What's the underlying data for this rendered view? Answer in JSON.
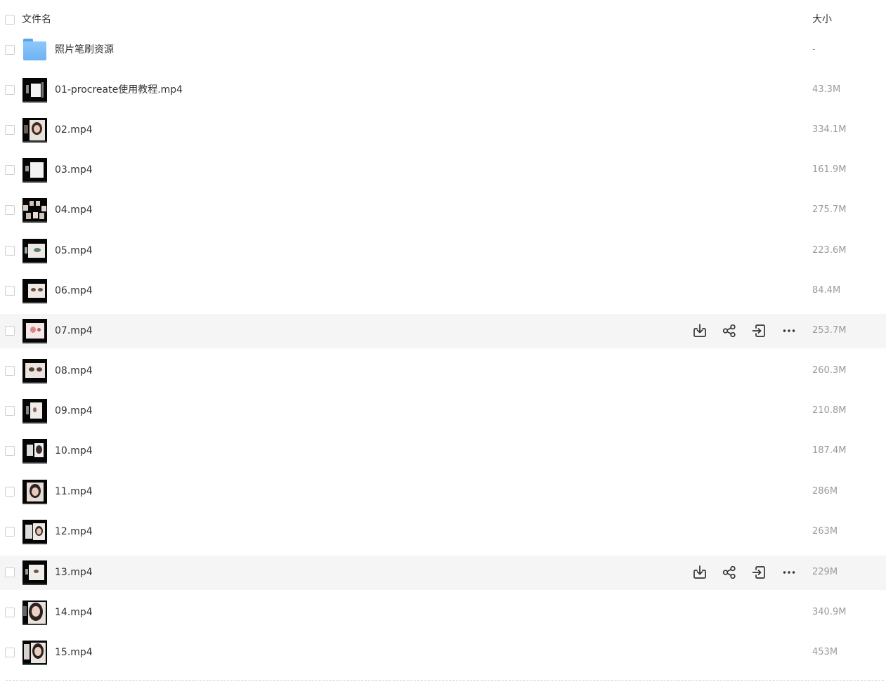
{
  "header": {
    "name_label": "文件名",
    "size_label": "大小"
  },
  "icons": {
    "download": "download-icon",
    "share": "share-icon",
    "move": "move-icon",
    "more": "more-icon",
    "folder": "folder-icon"
  },
  "files": [
    {
      "name": "照片笔刷资源",
      "size": "-",
      "type": "folder"
    },
    {
      "name": "01-procreate使用教程.mp4",
      "size": "43.3M",
      "type": "video"
    },
    {
      "name": "02.mp4",
      "size": "334.1M",
      "type": "video"
    },
    {
      "name": "03.mp4",
      "size": "161.9M",
      "type": "video"
    },
    {
      "name": "04.mp4",
      "size": "275.7M",
      "type": "video"
    },
    {
      "name": "05.mp4",
      "size": "223.6M",
      "type": "video"
    },
    {
      "name": "06.mp4",
      "size": "84.4M",
      "type": "video"
    },
    {
      "name": "07.mp4",
      "size": "253.7M",
      "type": "video",
      "hovered": true
    },
    {
      "name": "08.mp4",
      "size": "260.3M",
      "type": "video"
    },
    {
      "name": "09.mp4",
      "size": "210.8M",
      "type": "video"
    },
    {
      "name": "10.mp4",
      "size": "187.4M",
      "type": "video"
    },
    {
      "name": "11.mp4",
      "size": "286M",
      "type": "video"
    },
    {
      "name": "12.mp4",
      "size": "263M",
      "type": "video"
    },
    {
      "name": "13.mp4",
      "size": "229M",
      "type": "video",
      "hovered": true
    },
    {
      "name": "14.mp4",
      "size": "340.9M",
      "type": "video"
    },
    {
      "name": "15.mp4",
      "size": "453M",
      "type": "video"
    }
  ]
}
